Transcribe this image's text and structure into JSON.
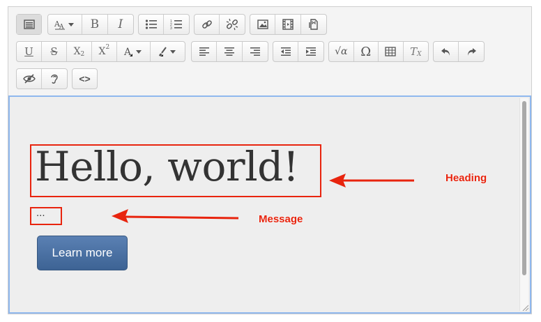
{
  "toolbar": {
    "row1": [
      {
        "name": "show-more-buttons",
        "icon": "toolbar-toggle-icon"
      },
      {
        "name": "font-family",
        "icon": "font-icon"
      },
      {
        "name": "bold",
        "label": "B"
      },
      {
        "name": "italic",
        "label": "I"
      },
      {
        "name": "unordered-list",
        "icon": "bullet-list-icon"
      },
      {
        "name": "ordered-list",
        "icon": "numbered-list-icon"
      },
      {
        "name": "link",
        "icon": "link-icon"
      },
      {
        "name": "unlink",
        "icon": "unlink-icon"
      },
      {
        "name": "image",
        "icon": "image-icon"
      },
      {
        "name": "media",
        "icon": "film-icon"
      },
      {
        "name": "manage-files",
        "icon": "file-icon"
      }
    ],
    "row2": [
      {
        "name": "underline",
        "label": "U"
      },
      {
        "name": "strikethrough",
        "label": "S"
      },
      {
        "name": "subscript",
        "label": "X",
        "sub": "2"
      },
      {
        "name": "superscript",
        "label": "X",
        "sup": "2"
      },
      {
        "name": "font-color",
        "label": "A"
      },
      {
        "name": "background-color",
        "icon": "paint-brush-icon"
      },
      {
        "name": "align-left",
        "icon": "align-left-icon"
      },
      {
        "name": "align-center",
        "icon": "align-center-icon"
      },
      {
        "name": "align-right",
        "icon": "align-right-icon"
      },
      {
        "name": "outdent",
        "icon": "outdent-icon"
      },
      {
        "name": "indent",
        "icon": "indent-icon"
      },
      {
        "name": "equation",
        "label": "√α"
      },
      {
        "name": "special-character",
        "label": "Ω"
      },
      {
        "name": "table",
        "icon": "table-icon"
      },
      {
        "name": "clear-formatting",
        "label": "T",
        "sub": "X"
      },
      {
        "name": "undo",
        "icon": "undo-icon"
      },
      {
        "name": "redo",
        "icon": "redo-icon"
      }
    ],
    "row3": [
      {
        "name": "accessibility-checker",
        "icon": "eye-slash-icon"
      },
      {
        "name": "screen-reader-helper",
        "icon": "ear-icon"
      },
      {
        "name": "html",
        "label": "<>"
      }
    ]
  },
  "content": {
    "heading": "Hello, world!",
    "message": "...",
    "button_label": "Learn more"
  },
  "annotations": {
    "heading_label": "Heading",
    "message_label": "Message",
    "color": "#e8240e"
  }
}
